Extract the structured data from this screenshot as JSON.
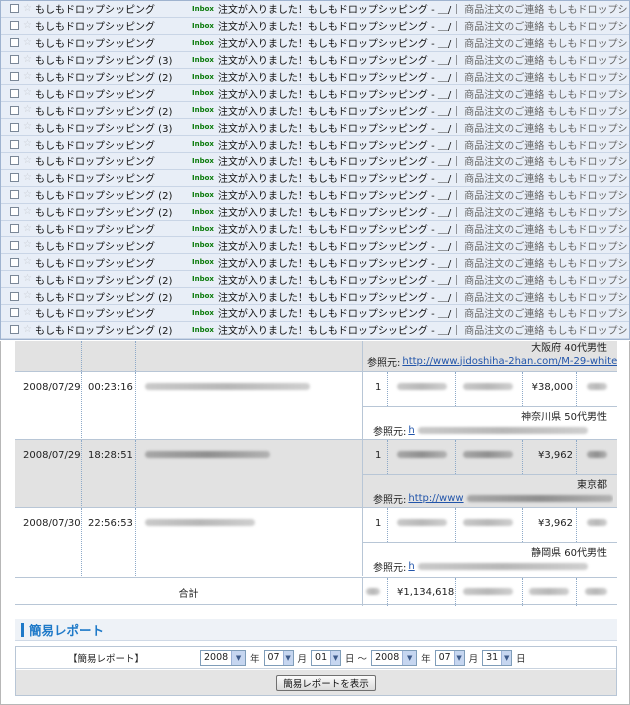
{
  "inbox": {
    "label": "Inbox",
    "subject": "注文が入りました！もしもドロップシッピング - ＿/｜",
    "snippet": "商品注文のご連絡 もしもドロップシッピング …",
    "rows": [
      {
        "sender": "もしもドロップシッピング"
      },
      {
        "sender": "もしもドロップシッピング"
      },
      {
        "sender": "もしもドロップシッピング"
      },
      {
        "sender": "もしもドロップシッピング (3)"
      },
      {
        "sender": "もしもドロップシッピング (2)"
      },
      {
        "sender": "もしもドロップシッピング"
      },
      {
        "sender": "もしもドロップシッピング (2)"
      },
      {
        "sender": "もしもドロップシッピング (3)"
      },
      {
        "sender": "もしもドロップシッピング"
      },
      {
        "sender": "もしもドロップシッピング"
      },
      {
        "sender": "もしもドロップシッピング"
      },
      {
        "sender": "もしもドロップシッピング (2)"
      },
      {
        "sender": "もしもドロップシッピング (2)"
      },
      {
        "sender": "もしもドロップシッピング"
      },
      {
        "sender": "もしもドロップシッピング"
      },
      {
        "sender": "もしもドロップシッピング"
      },
      {
        "sender": "もしもドロップシッピング (2)"
      },
      {
        "sender": "もしもドロップシッピング (2)"
      },
      {
        "sender": "もしもドロップシッピング"
      },
      {
        "sender": "もしもドロップシッピング (2)"
      }
    ]
  },
  "orders": {
    "top_partial": {
      "region": "大阪府 40代男性",
      "ref_label": "参照元:",
      "ref_url": "http://www.jidoshiha-2han.com/M-29-white-..."
    },
    "rows": [
      {
        "date": "2008/07/29",
        "time": "00:23:16",
        "qty": "1",
        "price": "¥38,000",
        "region": "神奈川県 50代男性",
        "ref_label": "参照元:",
        "ref_url": "h"
      },
      {
        "date": "2008/07/29",
        "time": "18:28:51",
        "qty": "1",
        "price": "¥3,962",
        "region": "東京都",
        "ref_label": "参照元:",
        "ref_url": "http://www"
      },
      {
        "date": "2008/07/30",
        "time": "22:56:53",
        "qty": "1",
        "price": "¥3,962",
        "region": "静岡県 60代男性",
        "ref_label": "参照元:",
        "ref_url": "h"
      }
    ],
    "total_label": "合計",
    "total_amount": "¥1,134,618"
  },
  "report": {
    "title": "簡易レポート",
    "form_label": "【簡易レポート】",
    "from": {
      "year": "2008",
      "month": "07",
      "day": "01"
    },
    "to": {
      "year": "2008",
      "month": "07",
      "day": "31"
    },
    "unit_year": "年",
    "unit_month": "月",
    "unit_day": "日",
    "range_sep": "日 ～",
    "show_button": "簡易レポートを表示"
  },
  "colors": {
    "inbox_bg": "#e8eef7",
    "label_green": "#0a7a0a",
    "accent_blue": "#1e79c8",
    "shaded_row": "#e2e2e2"
  }
}
